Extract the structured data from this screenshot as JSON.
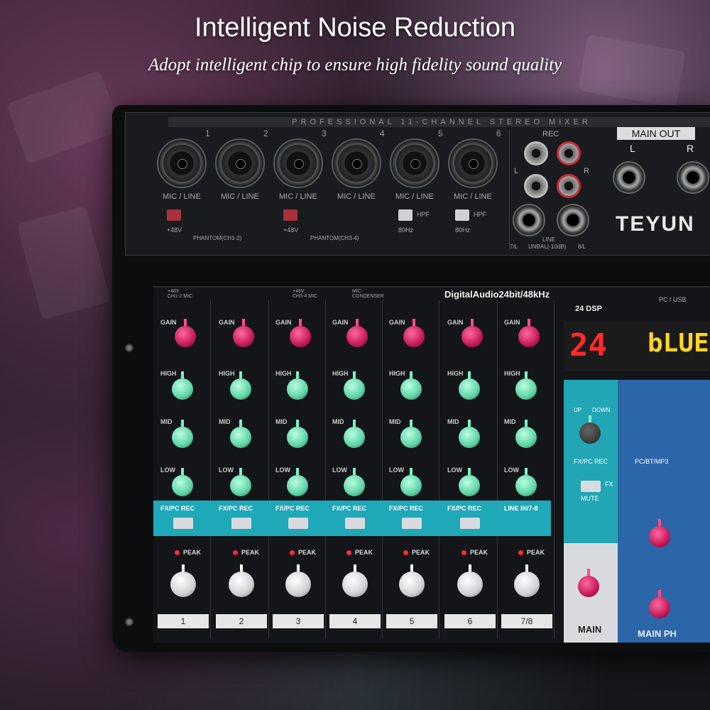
{
  "headline": "Intelligent Noise Reduction",
  "subline": "Adopt intelligent chip to ensure high fidelity sound quality",
  "mixer": {
    "top_strip_title": "PROFESSIONAL 11-CHANNEL STEREO MIXER",
    "mic_line_label": "MIC / LINE",
    "phantom_label": "+48V",
    "phantom_ch12": "PHANTOM(CH1-2)",
    "phantom_ch34": "PHANTOM(CH3-4)",
    "hpf_label": "HPF",
    "hpf_freq": "80Hz",
    "channel_numbers": [
      "1",
      "2",
      "3",
      "4",
      "5",
      "6"
    ],
    "rec_label": "REC",
    "rec_l": "L",
    "rec_r": "R",
    "line_label": "LINE",
    "line_ch7": "7/L",
    "line_unbal": "UNBAL(-10dB)",
    "line_ch8": "8/L",
    "main_out_label": "MAIN OUT",
    "main_out_l": "L",
    "main_out_r": "R",
    "brand": "TEYUN",
    "phantom_ch12_lower": "+48V\nCH1-2 MIC",
    "phantom_ch34_lower": "+48V\nCH3-4 MIC",
    "mic_condenser": "MIC\nCONDENSER",
    "digital_label": "DigitalAudio24bit/48kHz",
    "dsp_label": "24 DSP",
    "pc_usb": "PC / USB",
    "display_left": "24",
    "display_right": "bLUE",
    "gain_label": "GAIN",
    "high_label": "HIGH",
    "mid_label": "MID",
    "low_label": "LOW",
    "fx_labels": [
      "FX/PC REC",
      "FX/PC REC",
      "FX/PC REC",
      "FX/PC REC",
      "FX/PC REC",
      "FX/PC REC",
      "LINE IN/7-8"
    ],
    "peak_label": "PEAK",
    "channel_footers": [
      "1",
      "2",
      "3",
      "4",
      "5",
      "6",
      "7/8"
    ],
    "up_label": "UP",
    "down_label": "DOWN",
    "fx_pc_rec": "FX/PC REC",
    "mute_label": "MUTE",
    "fx_label": "FX",
    "pc_bt_mp3": "PC/BT/MP3",
    "main_label": "MAIN",
    "main_ph_label": "MAIN PH"
  },
  "colors": {
    "gain_knob": "#c51a5a",
    "eq_knob": "#5fd3a6",
    "fx_row": "#1fa8b8",
    "blue_panel": "#2b66a8"
  }
}
